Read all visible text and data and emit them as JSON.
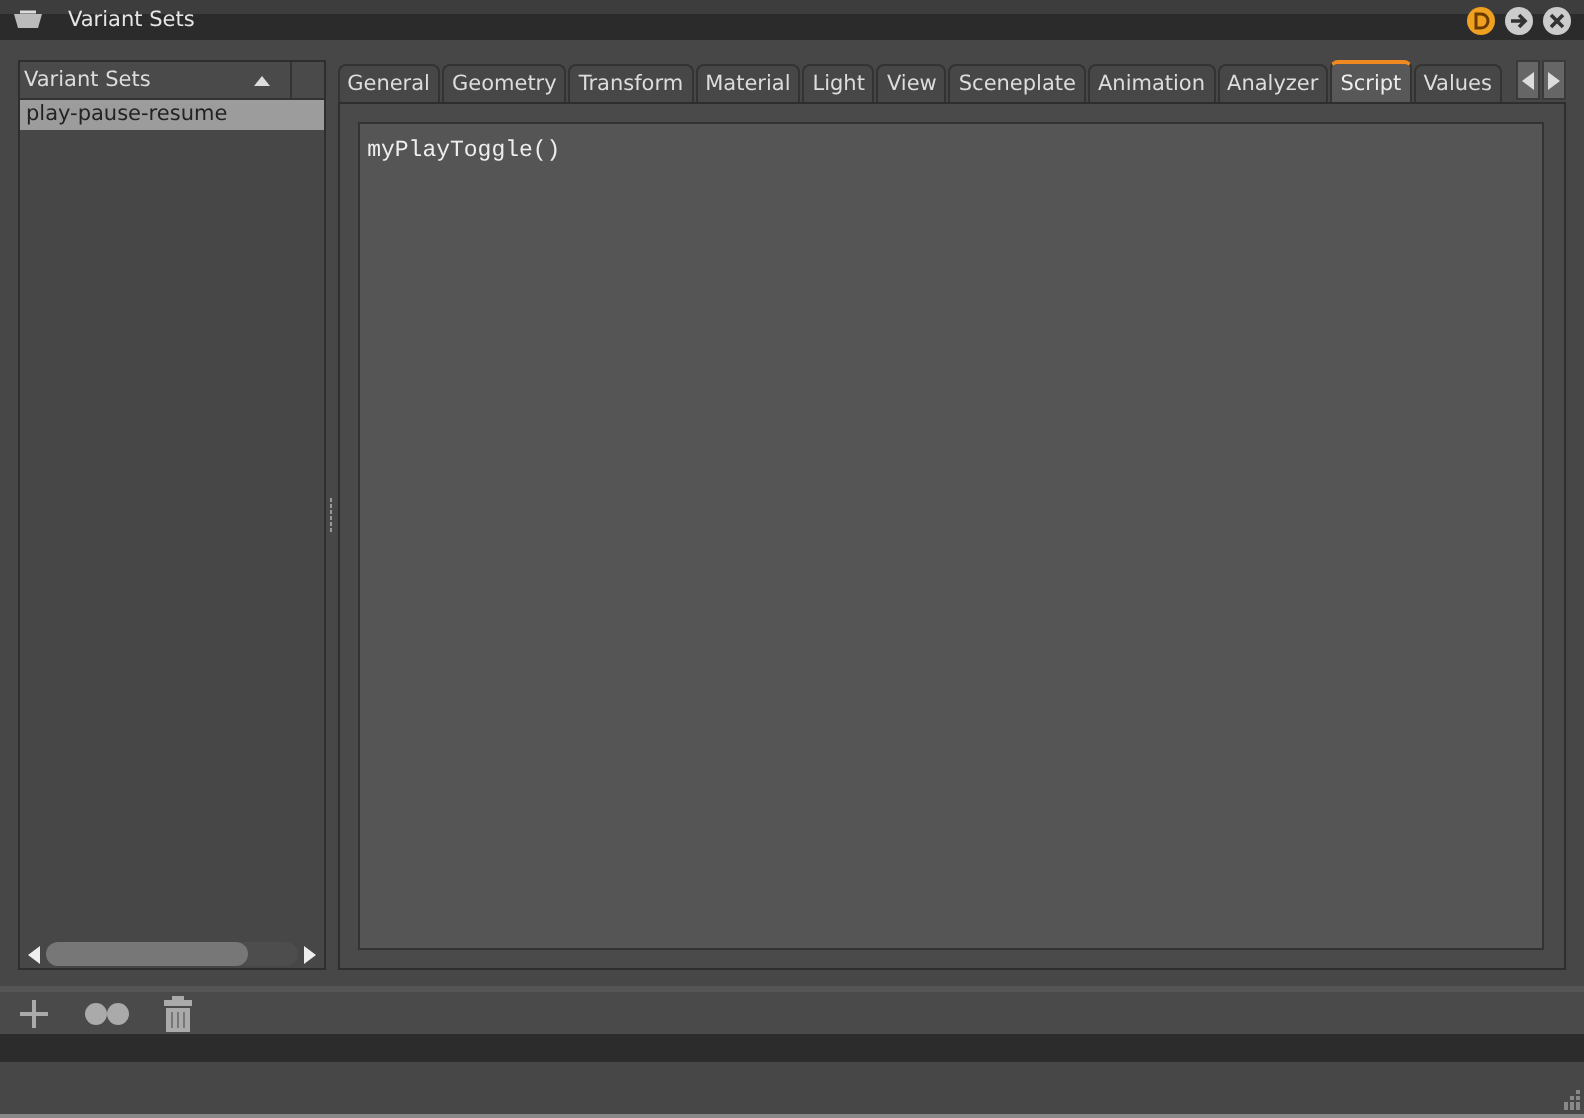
{
  "window": {
    "title": "Variant Sets"
  },
  "variant_list": {
    "header": "Variant Sets",
    "items": [
      {
        "label": "play-pause-resume",
        "selected": true
      }
    ]
  },
  "tabs": [
    {
      "label": "General",
      "selected": false
    },
    {
      "label": "Geometry",
      "selected": false
    },
    {
      "label": "Transform",
      "selected": false
    },
    {
      "label": "Material",
      "selected": false
    },
    {
      "label": "Light",
      "selected": false
    },
    {
      "label": "View",
      "selected": false
    },
    {
      "label": "Sceneplate",
      "selected": false
    },
    {
      "label": "Animation",
      "selected": false
    },
    {
      "label": "Analyzer",
      "selected": false
    },
    {
      "label": "Script",
      "selected": true
    },
    {
      "label": "Values",
      "selected": false
    }
  ],
  "script_editor": {
    "value": "myPlayToggle()"
  }
}
